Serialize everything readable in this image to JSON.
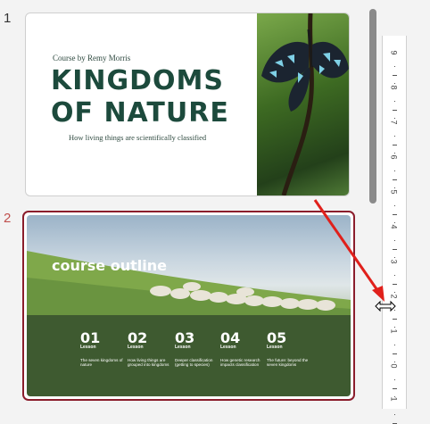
{
  "slide_panel": {
    "slides": [
      {
        "number": "1",
        "byline": "Course by Remy Morris",
        "title_line1": "KINGDOMS",
        "title_line2": "OF NATURE",
        "subtitle": "How living things are scientifically classified",
        "image": "butterfly-photo"
      },
      {
        "number": "2",
        "heading": "course outline",
        "image": "sheep-on-hillside-photo",
        "lessons": [
          {
            "num": "01",
            "label": "Lesson",
            "desc": "The seven kingdoms of nature"
          },
          {
            "num": "02",
            "label": "Lesson",
            "desc": "How living things are grouped into kingdoms"
          },
          {
            "num": "03",
            "label": "Lesson",
            "desc": "Deeper classification (getting to species)"
          },
          {
            "num": "04",
            "label": "Lesson",
            "desc": "How genetic research impacts classification"
          },
          {
            "num": "05",
            "label": "Lesson",
            "desc": "The future: beyond the seven kingdoms"
          }
        ]
      }
    ],
    "selected_slide": 2
  },
  "ruler": {
    "digits": [
      "9",
      "8",
      "7",
      "6",
      "5",
      "4",
      "3",
      "2",
      "1",
      "0",
      "1"
    ]
  },
  "colors": {
    "selected_border": "#8b1d2c",
    "selected_number": "#c0504d",
    "title_green": "#1c4a3c",
    "band_green": "#3e5a30",
    "annotation_arrow": "#e0201b"
  },
  "cursor": {
    "icon": "resize-horizontal-cursor-icon"
  }
}
